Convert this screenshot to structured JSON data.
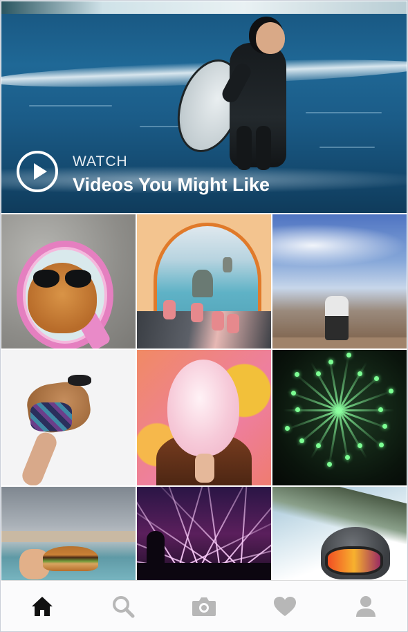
{
  "hero": {
    "watch_label": "WATCH",
    "title": "Videos You Might Like"
  },
  "grid": {
    "tiles": [
      {
        "subject": "cat with sunglasses in pink mirror"
      },
      {
        "subject": "view from tent at beach"
      },
      {
        "subject": "man kneeling at canyon"
      },
      {
        "subject": "dog in jacket held up"
      },
      {
        "subject": "cotton candy over face"
      },
      {
        "subject": "green fireworks"
      },
      {
        "subject": "burger at seaside"
      },
      {
        "subject": "laser light concert"
      },
      {
        "subject": "skier with goggles"
      }
    ]
  },
  "tabbar": {
    "tabs": [
      {
        "icon": "home-icon",
        "active": true
      },
      {
        "icon": "search-icon",
        "active": false
      },
      {
        "icon": "camera-icon",
        "active": false
      },
      {
        "icon": "heart-icon",
        "active": false
      },
      {
        "icon": "profile-icon",
        "active": false
      }
    ],
    "active_color": "#111111",
    "inactive_color": "#b7b7b7"
  }
}
